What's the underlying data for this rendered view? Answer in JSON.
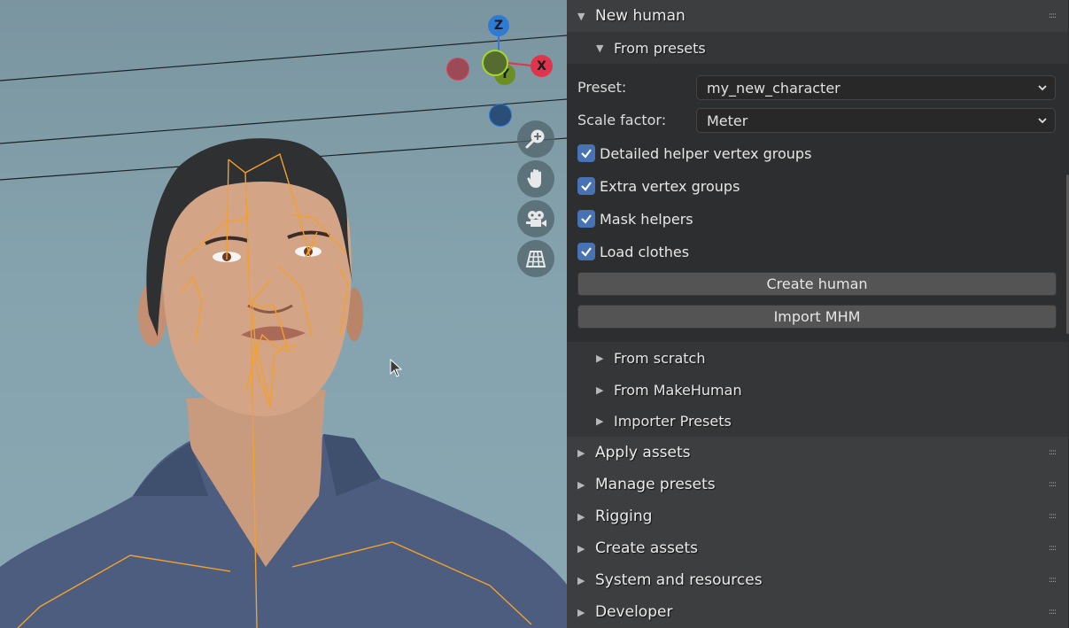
{
  "viewport": {
    "gizmo": {
      "z_label": "Z",
      "x_label": "X",
      "y_label": "Y",
      "colors": {
        "z": "#2e7bd6",
        "x": "#e0344c",
        "y": "#6b8e23",
        "neg_x": "#9c4a55",
        "neg_z": "#2a4e78",
        "center": "#556b2f"
      }
    },
    "nav_buttons": [
      {
        "name": "zoom-icon"
      },
      {
        "name": "pan-hand-icon"
      },
      {
        "name": "camera-icon"
      },
      {
        "name": "ortho-grid-icon"
      }
    ],
    "armature_color": "#f3a02c"
  },
  "panel": {
    "new_human": {
      "title": "New human",
      "expanded": true,
      "from_presets": {
        "title": "From presets",
        "expanded": true,
        "preset_label": "Preset:",
        "preset_value": "my_new_character",
        "scale_label": "Scale factor:",
        "scale_value": "Meter",
        "checkboxes": [
          {
            "label": "Detailed helper vertex groups",
            "checked": true
          },
          {
            "label": "Extra vertex groups",
            "checked": true
          },
          {
            "label": "Mask helpers",
            "checked": true
          },
          {
            "label": "Load clothes",
            "checked": true
          }
        ],
        "create_button": "Create human",
        "import_button": "Import MHM"
      },
      "subsections": [
        {
          "title": "From scratch"
        },
        {
          "title": "From MakeHuman"
        },
        {
          "title": "Importer Presets"
        }
      ]
    },
    "sections": [
      {
        "title": "Apply assets"
      },
      {
        "title": "Manage presets"
      },
      {
        "title": "Rigging"
      },
      {
        "title": "Create assets"
      },
      {
        "title": "System and resources"
      },
      {
        "title": "Developer"
      }
    ],
    "accent_color": "#4772b3"
  }
}
